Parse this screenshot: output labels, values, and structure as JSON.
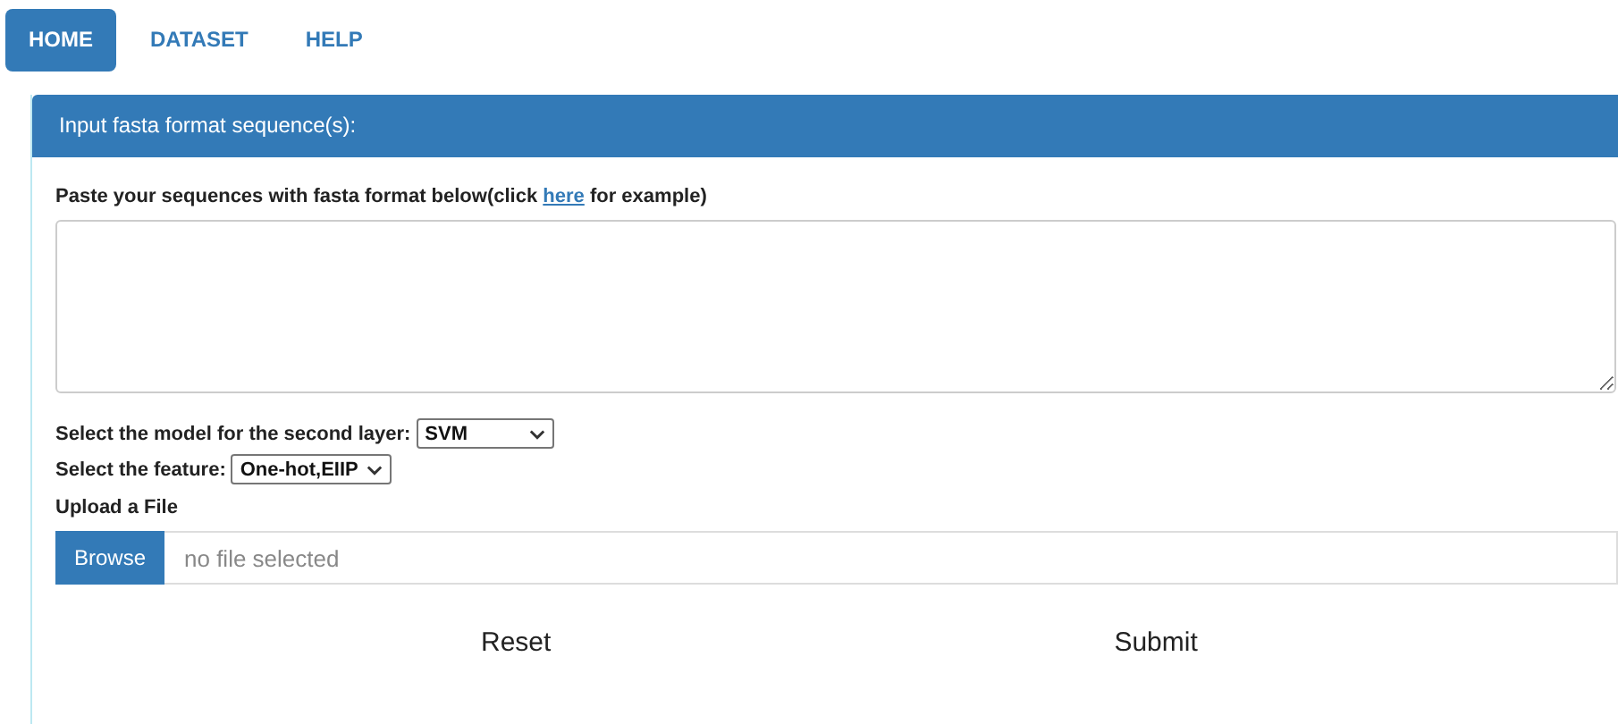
{
  "nav": {
    "tabs": [
      {
        "label": "HOME",
        "selected": true
      },
      {
        "label": "DATASET",
        "selected": false
      },
      {
        "label": "HELP",
        "selected": false
      }
    ]
  },
  "panel": {
    "title": "Input fasta format sequence(s):",
    "instruction": {
      "before": "Paste your sequences with fasta format below(click ",
      "link": "here",
      "after": " for example)"
    },
    "model_select": {
      "label": "Select the model for the second layer:",
      "value": "SVM"
    },
    "feature_select": {
      "label": "Select the feature:",
      "value": "One-hot,EIIP"
    },
    "upload": {
      "label": "Upload a File",
      "button": "Browse",
      "placeholder": "no file selected"
    },
    "buttons": [
      "Reset",
      "Submit"
    ]
  }
}
